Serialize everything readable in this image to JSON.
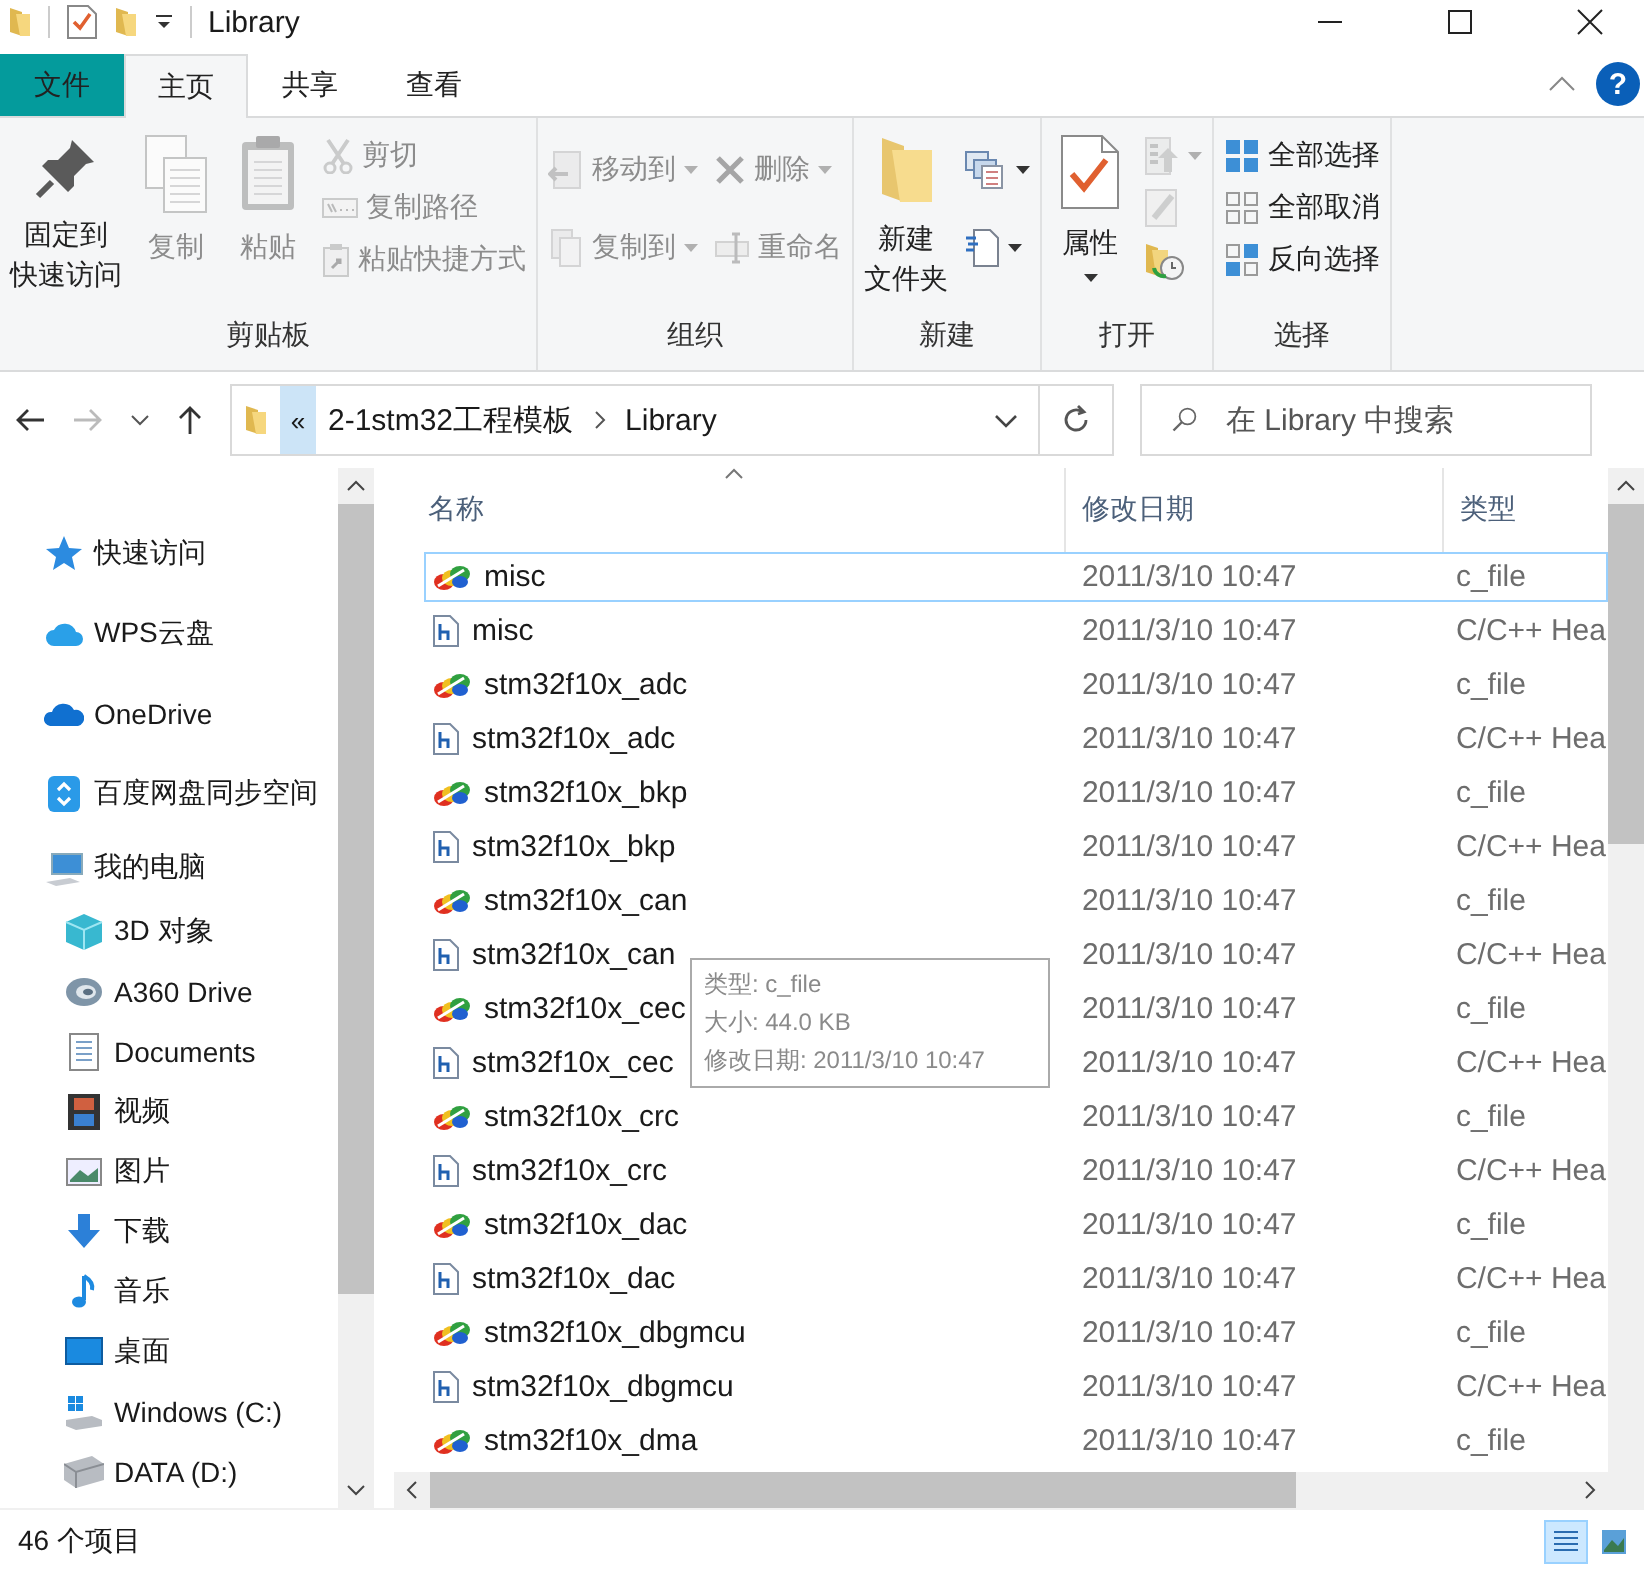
{
  "title_bar": {
    "title": "Library"
  },
  "ribbon_tabs": [
    {
      "label": "文件",
      "kind": "file",
      "selected": false
    },
    {
      "label": "主页",
      "kind": "tab",
      "selected": true
    },
    {
      "label": "共享",
      "kind": "tab",
      "selected": false
    },
    {
      "label": "查看",
      "kind": "tab",
      "selected": false
    }
  ],
  "help": {
    "label": "?"
  },
  "ribbon_groups": [
    {
      "label": "剪贴板",
      "columns": [
        [
          {
            "lines": [
              "固定到",
              "快速访问"
            ],
            "kind": "large",
            "disabled": false,
            "dropdown": false
          }
        ],
        [
          {
            "label": "复制",
            "kind": "large",
            "disabled": true,
            "dropdown": false
          }
        ],
        [
          {
            "label": "粘贴",
            "kind": "large",
            "disabled": true,
            "dropdown": false
          }
        ],
        [
          {
            "label": "剪切",
            "kind": "small",
            "disabled": true,
            "dropdown": false
          },
          {
            "label": "复制路径",
            "kind": "small",
            "disabled": true,
            "dropdown": false
          },
          {
            "label": "粘贴快捷方式",
            "kind": "small",
            "disabled": true,
            "dropdown": false
          }
        ]
      ]
    },
    {
      "label": "组织",
      "columns": [
        [
          {
            "label": "移动到",
            "kind": "wide",
            "disabled": true,
            "dropdown": true
          },
          {
            "label": "复制到",
            "kind": "wide",
            "disabled": true,
            "dropdown": true
          }
        ],
        [
          {
            "label": "删除",
            "kind": "wide",
            "disabled": true,
            "dropdown": true
          },
          {
            "label": "重命名",
            "kind": "wide",
            "disabled": true,
            "dropdown": false
          }
        ]
      ]
    },
    {
      "label": "新建",
      "columns": [
        [
          {
            "lines": [
              "新建",
              "文件夹"
            ],
            "kind": "large",
            "disabled": false,
            "dropdown": false
          }
        ],
        [
          {
            "kind": "wide",
            "disabled": false,
            "dropdown": true
          },
          {
            "kind": "wide",
            "disabled": false,
            "dropdown": true
          }
        ]
      ]
    },
    {
      "label": "打开",
      "columns": [
        [
          {
            "label": "属性",
            "kind": "large",
            "disabled": false,
            "dropdown": true
          }
        ],
        [
          {
            "kind": "small",
            "disabled": true,
            "dropdown": true
          },
          {
            "kind": "small",
            "disabled": true,
            "dropdown": false
          },
          {
            "kind": "small",
            "disabled": false,
            "dropdown": false
          }
        ]
      ]
    },
    {
      "label": "选择",
      "columns": [
        [
          {
            "label": "全部选择",
            "kind": "small",
            "disabled": false,
            "dropdown": false
          },
          {
            "label": "全部取消",
            "kind": "small",
            "disabled": false,
            "dropdown": false
          },
          {
            "label": "反向选择",
            "kind": "small",
            "disabled": false,
            "dropdown": false
          }
        ]
      ]
    }
  ],
  "address": {
    "overflow": "«",
    "path": [
      "2-1stm32工程模板",
      "Library"
    ]
  },
  "search": {
    "placeholder": "在 Library 中搜索"
  },
  "sidebar": [
    {
      "label": "快速访问"
    },
    {
      "label": "WPS云盘"
    },
    {
      "label": "OneDrive"
    },
    {
      "label": "百度网盘同步空间"
    },
    {
      "label": "我的电脑",
      "children": [
        {
          "label": "3D 对象"
        },
        {
          "label": "A360 Drive"
        },
        {
          "label": "Documents"
        },
        {
          "label": "视频"
        },
        {
          "label": "图片"
        },
        {
          "label": "下载"
        },
        {
          "label": "音乐"
        },
        {
          "label": "桌面"
        },
        {
          "label": "Windows (C:)"
        },
        {
          "label": "DATA (D:)"
        }
      ]
    }
  ],
  "columns": [
    "名称",
    "修改日期",
    "类型"
  ],
  "files": [
    {
      "name": "misc",
      "kind": "c",
      "date": "2011/3/10 10:47",
      "type": "c_file",
      "selected": true
    },
    {
      "name": "misc",
      "kind": "h",
      "date": "2011/3/10 10:47",
      "type": "C/C++ Hea",
      "selected": false
    },
    {
      "name": "stm32f10x_adc",
      "kind": "c",
      "date": "2011/3/10 10:47",
      "type": "c_file",
      "selected": false
    },
    {
      "name": "stm32f10x_adc",
      "kind": "h",
      "date": "2011/3/10 10:47",
      "type": "C/C++ Hea",
      "selected": false
    },
    {
      "name": "stm32f10x_bkp",
      "kind": "c",
      "date": "2011/3/10 10:47",
      "type": "c_file",
      "selected": false
    },
    {
      "name": "stm32f10x_bkp",
      "kind": "h",
      "date": "2011/3/10 10:47",
      "type": "C/C++ Hea",
      "selected": false
    },
    {
      "name": "stm32f10x_can",
      "kind": "c",
      "date": "2011/3/10 10:47",
      "type": "c_file",
      "selected": false
    },
    {
      "name": "stm32f10x_can",
      "kind": "h",
      "date": "2011/3/10 10:47",
      "type": "C/C++ Hea",
      "selected": false
    },
    {
      "name": "stm32f10x_cec",
      "kind": "c",
      "date": "2011/3/10 10:47",
      "type": "c_file",
      "selected": false
    },
    {
      "name": "stm32f10x_cec",
      "kind": "h",
      "date": "2011/3/10 10:47",
      "type": "C/C++ Hea",
      "selected": false
    },
    {
      "name": "stm32f10x_crc",
      "kind": "c",
      "date": "2011/3/10 10:47",
      "type": "c_file",
      "selected": false
    },
    {
      "name": "stm32f10x_crc",
      "kind": "h",
      "date": "2011/3/10 10:47",
      "type": "C/C++ Hea",
      "selected": false
    },
    {
      "name": "stm32f10x_dac",
      "kind": "c",
      "date": "2011/3/10 10:47",
      "type": "c_file",
      "selected": false
    },
    {
      "name": "stm32f10x_dac",
      "kind": "h",
      "date": "2011/3/10 10:47",
      "type": "C/C++ Hea",
      "selected": false
    },
    {
      "name": "stm32f10x_dbgmcu",
      "kind": "c",
      "date": "2011/3/10 10:47",
      "type": "c_file",
      "selected": false
    },
    {
      "name": "stm32f10x_dbgmcu",
      "kind": "h",
      "date": "2011/3/10 10:47",
      "type": "C/C++ Hea",
      "selected": false
    },
    {
      "name": "stm32f10x_dma",
      "kind": "c",
      "date": "2011/3/10 10:47",
      "type": "c_file",
      "selected": false
    }
  ],
  "tooltip": [
    "类型: c_file",
    "大小: 44.0 KB",
    "修改日期: 2011/3/10 10:47"
  ],
  "status_bar": {
    "count": "46 个项目",
    "views": [
      {
        "selected": true
      },
      {
        "selected": false
      }
    ]
  }
}
